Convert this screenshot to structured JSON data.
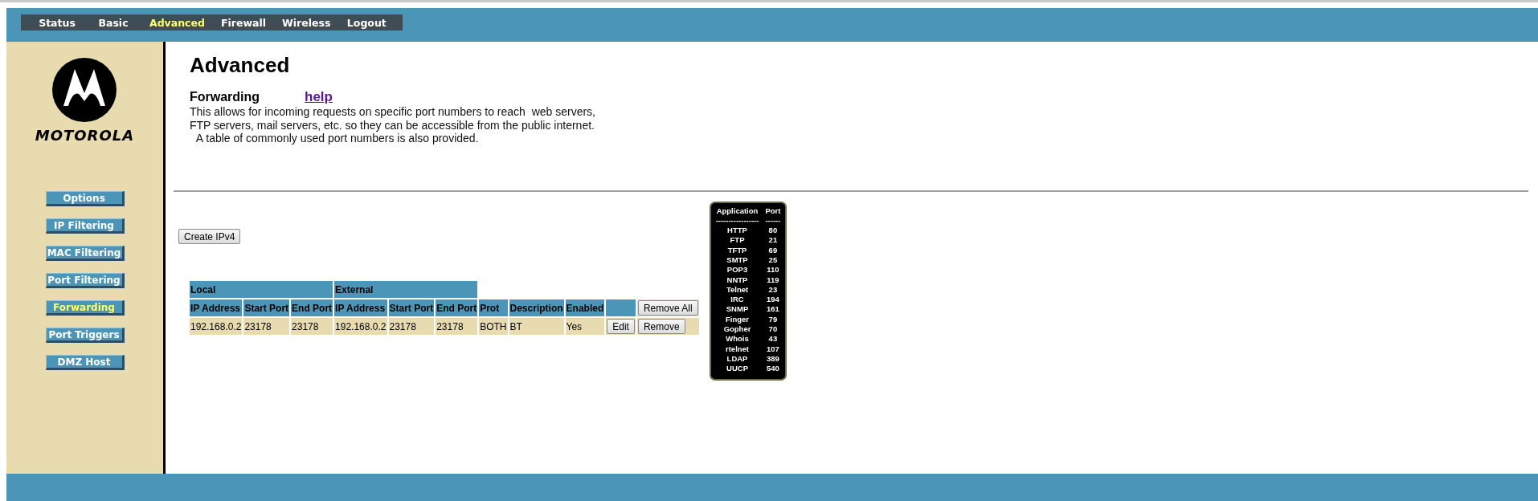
{
  "top_nav": [
    {
      "label": "Status",
      "selected": false
    },
    {
      "label": "Basic",
      "selected": false
    },
    {
      "label": "Advanced",
      "selected": true
    },
    {
      "label": "Firewall",
      "selected": false
    },
    {
      "label": "Wireless",
      "selected": false
    },
    {
      "label": "Logout",
      "selected": false
    }
  ],
  "brand": {
    "name": "MOTOROLA"
  },
  "sidebar": {
    "items": [
      {
        "label": "Options",
        "selected": false
      },
      {
        "label": "IP Filtering",
        "selected": false
      },
      {
        "label": "MAC Filtering",
        "selected": false
      },
      {
        "label": "Port Filtering",
        "selected": false
      },
      {
        "label": "Forwarding",
        "selected": true
      },
      {
        "label": "Port Triggers",
        "selected": false
      },
      {
        "label": "DMZ Host",
        "selected": false
      }
    ]
  },
  "page": {
    "title": "Advanced",
    "section": "Forwarding",
    "help_link": "help",
    "description": "This allows for incoming requests on specific port numbers to reach  web servers,\nFTP servers, mail servers, etc. so they can be accessible from the public internet.\n  A table of commonly used port numbers is also provided."
  },
  "create_button": "Create IPv4",
  "table": {
    "groups": [
      {
        "label": "Local"
      },
      {
        "label": "External"
      }
    ],
    "columns": [
      "IP Address",
      "Start Port",
      "End Port",
      "IP Address",
      "Start Port",
      "End Port",
      "Prot",
      "Description",
      "Enabled"
    ],
    "remove_all_button": "Remove All",
    "rows": [
      {
        "cells": [
          "192.168.0.2",
          "23178",
          "23178",
          "192.168.0.2",
          "23178",
          "23178",
          "BOTH",
          "BT",
          "Yes"
        ],
        "edit_button": "Edit",
        "remove_button": "Remove"
      }
    ]
  },
  "port_reference": {
    "headers": [
      "Application",
      "Port"
    ],
    "rules": [
      "-----------------",
      "------"
    ],
    "rows": [
      [
        "HTTP",
        "80"
      ],
      [
        "FTP",
        "21"
      ],
      [
        "TFTP",
        "69"
      ],
      [
        "SMTP",
        "25"
      ],
      [
        "POP3",
        "110"
      ],
      [
        "NNTP",
        "119"
      ],
      [
        "Telnet",
        "23"
      ],
      [
        "IRC",
        "194"
      ],
      [
        "SNMP",
        "161"
      ],
      [
        "Finger",
        "79"
      ],
      [
        "Gopher",
        "70"
      ],
      [
        "Whois",
        "43"
      ],
      [
        "rtelnet",
        "107"
      ],
      [
        "LDAP",
        "389"
      ],
      [
        "UUCP",
        "540"
      ]
    ]
  }
}
